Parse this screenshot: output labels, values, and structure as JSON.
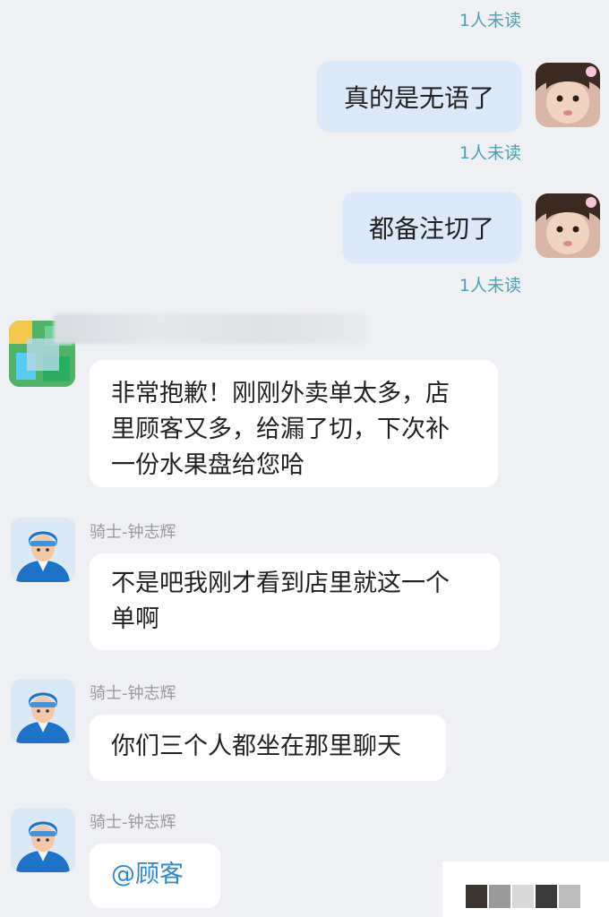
{
  "messages": [
    {
      "type": "read_status",
      "text": "1人未读"
    },
    {
      "type": "outgoing",
      "text": "真的是无语了",
      "status": "1人未读"
    },
    {
      "type": "outgoing",
      "text": "都备注切了",
      "status": "1人未读"
    },
    {
      "type": "incoming",
      "sender": "",
      "lines": [
        "非常抱歉！刚刚外卖单太多，店",
        "里顾客又多，给漏了切，下次补",
        "一份水果盘给您哈"
      ]
    },
    {
      "type": "incoming",
      "sender": "骑士-钟志辉",
      "lines": [
        "不是吧我刚才看到店里就这一个",
        "单啊"
      ]
    },
    {
      "type": "incoming",
      "sender": "骑士-钟志辉",
      "lines": [
        "你们三个人都坐在那里聊天"
      ]
    },
    {
      "type": "incoming",
      "sender": "骑士-钟志辉",
      "lines": [
        "@顾客"
      ]
    }
  ],
  "icons": {
    "user_avatar": "girl-avatar-icon",
    "rider_avatar": "rider-avatar-icon",
    "shop_avatar": "shop-avatar-icon"
  },
  "colors": {
    "background": "#eef0f4",
    "outgoing_bubble": "#dbe9f8",
    "incoming_bubble": "#ffffff",
    "read_status": "#4aa3b4",
    "mention": "#2e87d6"
  }
}
